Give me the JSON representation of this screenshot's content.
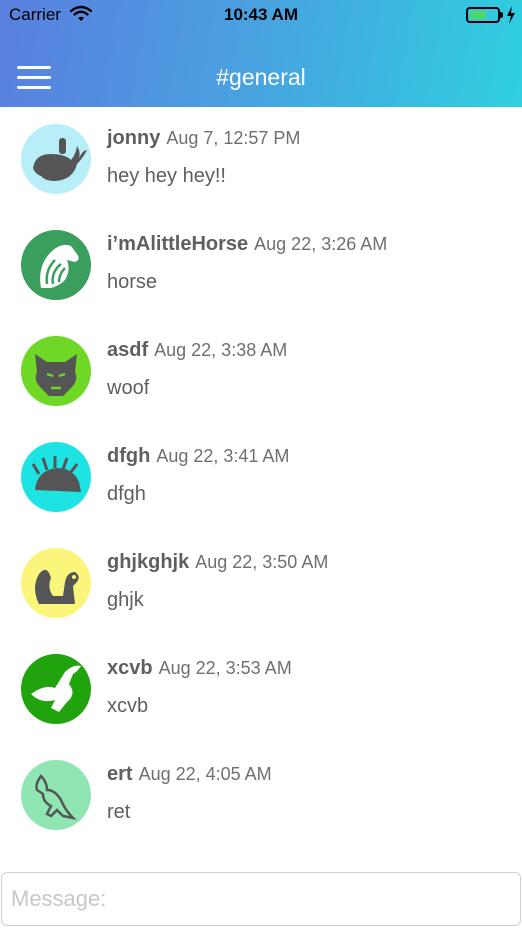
{
  "status_bar": {
    "carrier": "Carrier",
    "time": "10:43 AM",
    "battery_level": 0.6
  },
  "header": {
    "channel": "#general"
  },
  "messages": [
    {
      "user": "jonny",
      "time": "Aug 7, 12:57 PM",
      "text": "hey hey hey!!",
      "avatar_bg": "#b8eef7",
      "avatar_icon": "whale-icon"
    },
    {
      "user": "i’mAlittleHorse",
      "time": "Aug 22, 3:26 AM",
      "text": "horse",
      "avatar_bg": "#3a9f5c",
      "avatar_icon": "horse-icon"
    },
    {
      "user": "asdf",
      "time": "Aug 22, 3:38 AM",
      "text": "woof",
      "avatar_bg": "#6fd826",
      "avatar_icon": "wolf-icon"
    },
    {
      "user": "dfgh",
      "time": "Aug 22, 3:41 AM",
      "text": "dfgh",
      "avatar_bg": "#1de3e3",
      "avatar_icon": "porcupine-icon"
    },
    {
      "user": "ghjkghjk",
      "time": "Aug 22, 3:50 AM",
      "text": "ghjk",
      "avatar_bg": "#fbf57c",
      "avatar_icon": "squirrel-icon"
    },
    {
      "user": "xcvb",
      "time": "Aug 22, 3:53 AM",
      "text": "xcvb",
      "avatar_bg": "#20a30c",
      "avatar_icon": "eagle-icon"
    },
    {
      "user": "ert",
      "time": "Aug 22, 4:05 AM",
      "text": "ret",
      "avatar_bg": "#8fe6b2",
      "avatar_icon": "kangaroo-icon"
    }
  ],
  "composer": {
    "placeholder": "Message:"
  },
  "colors": {
    "gradient_start": "#5a7fe0",
    "gradient_end": "#2fcfe0",
    "text": "#5f5f5f"
  }
}
